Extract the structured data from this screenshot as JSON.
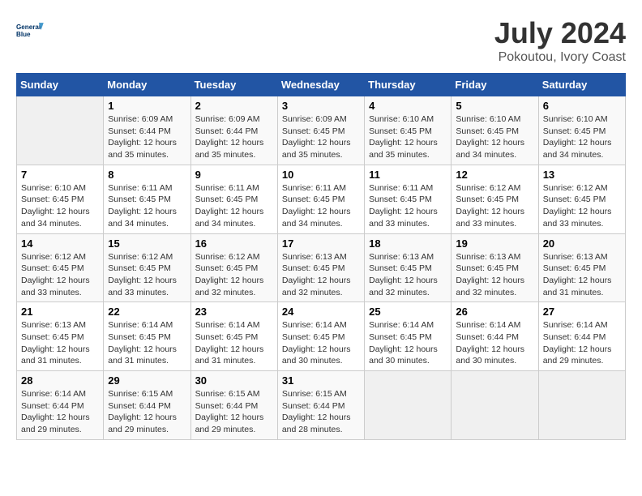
{
  "header": {
    "logo_line1": "General",
    "logo_line2": "Blue",
    "main_title": "July 2024",
    "subtitle": "Pokoutou, Ivory Coast"
  },
  "days_of_week": [
    "Sunday",
    "Monday",
    "Tuesday",
    "Wednesday",
    "Thursday",
    "Friday",
    "Saturday"
  ],
  "weeks": [
    [
      {
        "day": "",
        "info": ""
      },
      {
        "day": "1",
        "info": "Sunrise: 6:09 AM\nSunset: 6:44 PM\nDaylight: 12 hours\nand 35 minutes."
      },
      {
        "day": "2",
        "info": "Sunrise: 6:09 AM\nSunset: 6:44 PM\nDaylight: 12 hours\nand 35 minutes."
      },
      {
        "day": "3",
        "info": "Sunrise: 6:09 AM\nSunset: 6:45 PM\nDaylight: 12 hours\nand 35 minutes."
      },
      {
        "day": "4",
        "info": "Sunrise: 6:10 AM\nSunset: 6:45 PM\nDaylight: 12 hours\nand 35 minutes."
      },
      {
        "day": "5",
        "info": "Sunrise: 6:10 AM\nSunset: 6:45 PM\nDaylight: 12 hours\nand 34 minutes."
      },
      {
        "day": "6",
        "info": "Sunrise: 6:10 AM\nSunset: 6:45 PM\nDaylight: 12 hours\nand 34 minutes."
      }
    ],
    [
      {
        "day": "7",
        "info": "Sunrise: 6:10 AM\nSunset: 6:45 PM\nDaylight: 12 hours\nand 34 minutes."
      },
      {
        "day": "8",
        "info": "Sunrise: 6:11 AM\nSunset: 6:45 PM\nDaylight: 12 hours\nand 34 minutes."
      },
      {
        "day": "9",
        "info": "Sunrise: 6:11 AM\nSunset: 6:45 PM\nDaylight: 12 hours\nand 34 minutes."
      },
      {
        "day": "10",
        "info": "Sunrise: 6:11 AM\nSunset: 6:45 PM\nDaylight: 12 hours\nand 34 minutes."
      },
      {
        "day": "11",
        "info": "Sunrise: 6:11 AM\nSunset: 6:45 PM\nDaylight: 12 hours\nand 33 minutes."
      },
      {
        "day": "12",
        "info": "Sunrise: 6:12 AM\nSunset: 6:45 PM\nDaylight: 12 hours\nand 33 minutes."
      },
      {
        "day": "13",
        "info": "Sunrise: 6:12 AM\nSunset: 6:45 PM\nDaylight: 12 hours\nand 33 minutes."
      }
    ],
    [
      {
        "day": "14",
        "info": "Sunrise: 6:12 AM\nSunset: 6:45 PM\nDaylight: 12 hours\nand 33 minutes."
      },
      {
        "day": "15",
        "info": "Sunrise: 6:12 AM\nSunset: 6:45 PM\nDaylight: 12 hours\nand 33 minutes."
      },
      {
        "day": "16",
        "info": "Sunrise: 6:12 AM\nSunset: 6:45 PM\nDaylight: 12 hours\nand 32 minutes."
      },
      {
        "day": "17",
        "info": "Sunrise: 6:13 AM\nSunset: 6:45 PM\nDaylight: 12 hours\nand 32 minutes."
      },
      {
        "day": "18",
        "info": "Sunrise: 6:13 AM\nSunset: 6:45 PM\nDaylight: 12 hours\nand 32 minutes."
      },
      {
        "day": "19",
        "info": "Sunrise: 6:13 AM\nSunset: 6:45 PM\nDaylight: 12 hours\nand 32 minutes."
      },
      {
        "day": "20",
        "info": "Sunrise: 6:13 AM\nSunset: 6:45 PM\nDaylight: 12 hours\nand 31 minutes."
      }
    ],
    [
      {
        "day": "21",
        "info": "Sunrise: 6:13 AM\nSunset: 6:45 PM\nDaylight: 12 hours\nand 31 minutes."
      },
      {
        "day": "22",
        "info": "Sunrise: 6:14 AM\nSunset: 6:45 PM\nDaylight: 12 hours\nand 31 minutes."
      },
      {
        "day": "23",
        "info": "Sunrise: 6:14 AM\nSunset: 6:45 PM\nDaylight: 12 hours\nand 31 minutes."
      },
      {
        "day": "24",
        "info": "Sunrise: 6:14 AM\nSunset: 6:45 PM\nDaylight: 12 hours\nand 30 minutes."
      },
      {
        "day": "25",
        "info": "Sunrise: 6:14 AM\nSunset: 6:45 PM\nDaylight: 12 hours\nand 30 minutes."
      },
      {
        "day": "26",
        "info": "Sunrise: 6:14 AM\nSunset: 6:44 PM\nDaylight: 12 hours\nand 30 minutes."
      },
      {
        "day": "27",
        "info": "Sunrise: 6:14 AM\nSunset: 6:44 PM\nDaylight: 12 hours\nand 29 minutes."
      }
    ],
    [
      {
        "day": "28",
        "info": "Sunrise: 6:14 AM\nSunset: 6:44 PM\nDaylight: 12 hours\nand 29 minutes."
      },
      {
        "day": "29",
        "info": "Sunrise: 6:15 AM\nSunset: 6:44 PM\nDaylight: 12 hours\nand 29 minutes."
      },
      {
        "day": "30",
        "info": "Sunrise: 6:15 AM\nSunset: 6:44 PM\nDaylight: 12 hours\nand 29 minutes."
      },
      {
        "day": "31",
        "info": "Sunrise: 6:15 AM\nSunset: 6:44 PM\nDaylight: 12 hours\nand 28 minutes."
      },
      {
        "day": "",
        "info": ""
      },
      {
        "day": "",
        "info": ""
      },
      {
        "day": "",
        "info": ""
      }
    ]
  ]
}
